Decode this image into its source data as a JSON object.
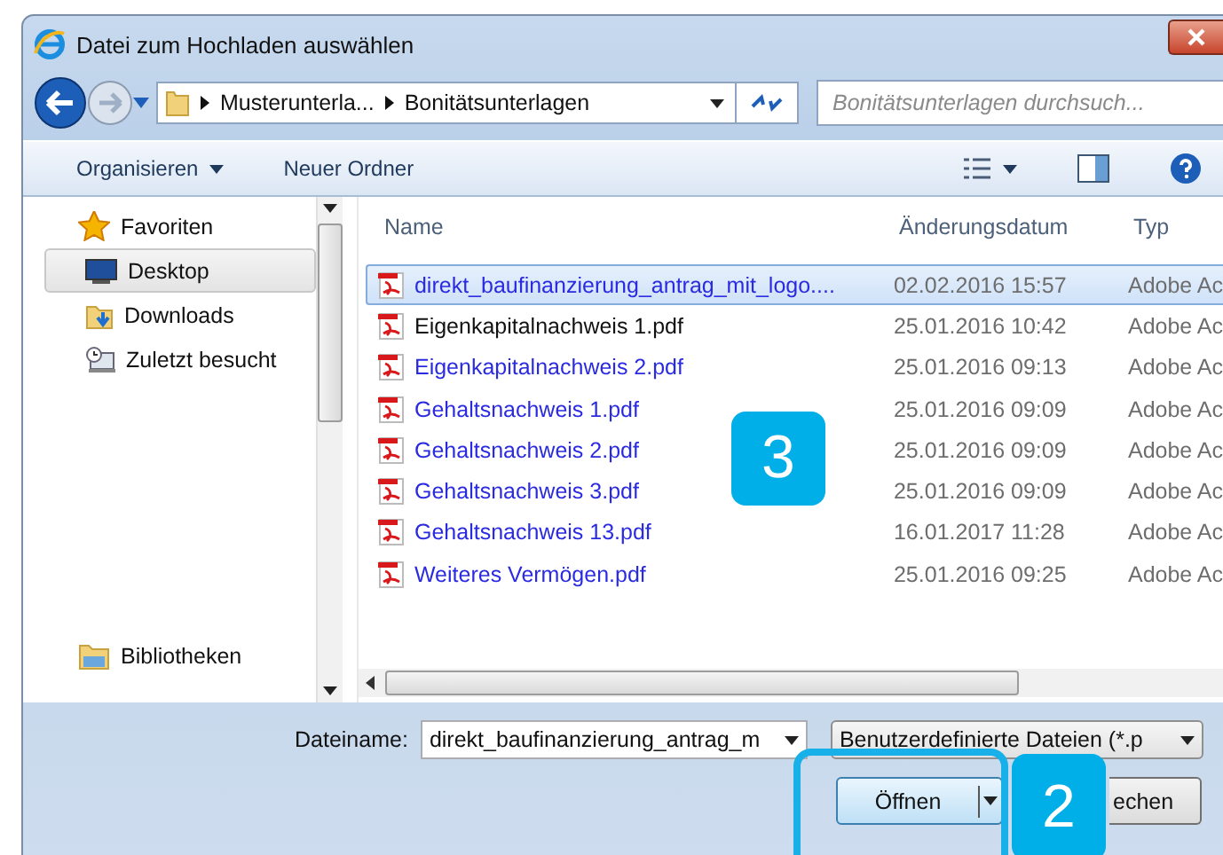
{
  "window": {
    "title": "Datei zum Hochladen auswählen"
  },
  "address": {
    "path": [
      "Musterunterla...",
      "Bonitätsunterlagen"
    ]
  },
  "search": {
    "placeholder": "Bonitätsunterlagen durchsuch..."
  },
  "toolbar": {
    "organize": "Organisieren",
    "new_folder": "Neuer Ordner"
  },
  "navigation": {
    "favorites": {
      "label": "Favoriten",
      "children": [
        {
          "label": "Desktop",
          "kind": "desktop",
          "selected": true
        },
        {
          "label": "Downloads",
          "kind": "downloads",
          "selected": false
        },
        {
          "label": "Zuletzt besucht",
          "kind": "recent",
          "selected": false
        }
      ]
    },
    "libraries": {
      "label": "Bibliotheken"
    }
  },
  "file_list": {
    "columns": [
      "Name",
      "Änderungsdatum",
      "Typ"
    ],
    "rows": [
      {
        "name": "direkt_baufinanzierung_antrag_mit_logo....",
        "modified": "02.02.2016 15:57",
        "type": "Adobe Ac",
        "color": "#2a2ae0",
        "selected": true
      },
      {
        "name": "Eigenkapitalnachweis 1.pdf",
        "modified": "25.01.2016 10:42",
        "type": "Adobe Ac",
        "color": "#111111",
        "selected": false
      },
      {
        "name": "Eigenkapitalnachweis 2.pdf",
        "modified": "25.01.2016 09:13",
        "type": "Adobe Ac",
        "color": "#2a2ae0",
        "selected": false
      },
      {
        "name": "Gehaltsnachweis 1.pdf",
        "modified": "25.01.2016 09:09",
        "type": "Adobe Ac",
        "color": "#2a2ae0",
        "selected": false
      },
      {
        "name": "Gehaltsnachweis 2.pdf",
        "modified": "25.01.2016 09:09",
        "type": "Adobe Ac",
        "color": "#2a2ae0",
        "selected": false
      },
      {
        "name": "Gehaltsnachweis 3.pdf",
        "modified": "25.01.2016 09:09",
        "type": "Adobe Ac",
        "color": "#2a2ae0",
        "selected": false
      },
      {
        "name": "Gehaltsnachweis 13.pdf",
        "modified": "16.01.2017 11:28",
        "type": "Adobe Ac",
        "color": "#2a2ae0",
        "selected": false
      },
      {
        "name": "Weiteres Vermögen.pdf",
        "modified": "25.01.2016 09:25",
        "type": "Adobe Ac",
        "color": "#2a2ae0",
        "selected": false
      }
    ]
  },
  "file_name": {
    "label": "Dateiname:",
    "value": "direkt_baufinanzierung_antrag_m"
  },
  "file_type": {
    "value": "Benutzerdefinierte Dateien (*.p"
  },
  "buttons": [
    {
      "label": "Öffnen"
    },
    {
      "label": "echen"
    }
  ],
  "annotations": [
    {
      "label": "3"
    },
    {
      "label": "2"
    }
  ]
}
